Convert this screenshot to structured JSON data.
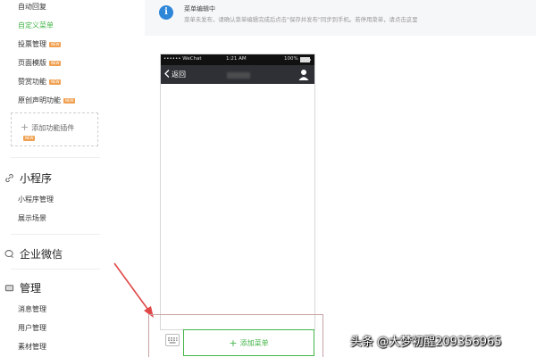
{
  "sidebar": {
    "items_top": [
      {
        "label": "自动回复",
        "active": false,
        "badge": ""
      },
      {
        "label": "自定义菜单",
        "active": true,
        "badge": ""
      },
      {
        "label": "投票管理",
        "active": false,
        "badge": "NEW"
      },
      {
        "label": "页面模版",
        "active": false,
        "badge": "NEW"
      },
      {
        "label": "赞赏功能",
        "active": false,
        "badge": "NEW"
      },
      {
        "label": "原创声明功能",
        "active": false,
        "badge": "NEW"
      }
    ],
    "add_plugin": {
      "label": "添加功能插件",
      "badge": "NEW"
    },
    "sections": [
      {
        "title": "小程序",
        "icon": "link-icon",
        "items": [
          "小程序管理",
          "展示场景"
        ]
      },
      {
        "title": "企业微信",
        "icon": "chat-icon",
        "items": []
      },
      {
        "title": "管理",
        "icon": "folder-icon",
        "items": [
          "消息管理",
          "用户管理",
          "素材管理"
        ]
      }
    ]
  },
  "tip": {
    "icon": "info-icon",
    "title": "菜单编辑中",
    "description": "菜单未发布，请确认菜单编辑完成后点击\"保存并发布\"同步到手机。若停用菜单，请点击这里"
  },
  "phone": {
    "carrier": "•••••• WeChat",
    "time": "1:21 AM",
    "battery": "100%",
    "back_label": "返回"
  },
  "menu_bar": {
    "add_menu_label": "添加菜单"
  },
  "watermark": "头条 @大梦初醒209356965",
  "colors": {
    "accent_green": "#44b549",
    "info_blue": "#2e86d8",
    "arrow_red": "#e04848",
    "badge_orange": "#f0a050"
  }
}
